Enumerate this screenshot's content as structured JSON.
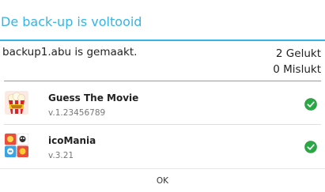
{
  "dialog": {
    "title": "De back-up is voltooid",
    "accent_color": "#33b5e5"
  },
  "summary": {
    "message": "backup1.abu is gemaakt.",
    "success_count": "2 Gelukt",
    "failed_count": "0 Mislukt"
  },
  "apps": [
    {
      "name": "Guess The Movie",
      "version": "v.1.23456789",
      "icon": "guess-the-movie-icon",
      "status": "success"
    },
    {
      "name": "icoMania",
      "version": "v.3.21",
      "icon": "icomania-icon",
      "status": "success"
    }
  ],
  "status_color": "#2aa844",
  "buttons": {
    "ok_label": "OK"
  }
}
